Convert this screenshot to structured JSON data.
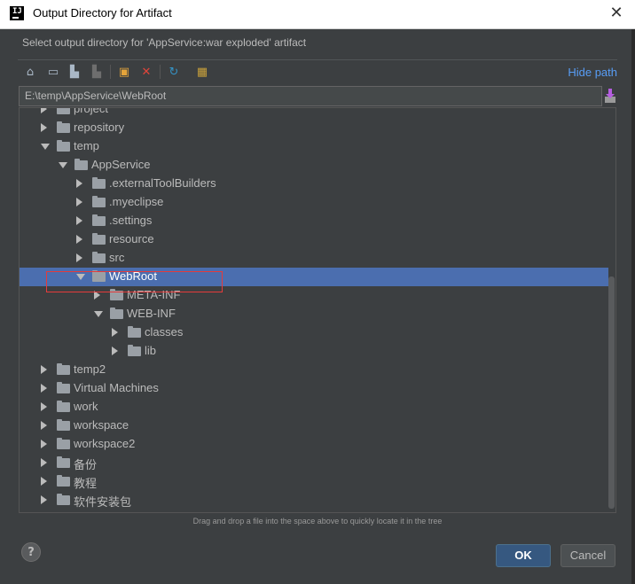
{
  "window": {
    "title": "Output Directory for Artifact",
    "close": "✕"
  },
  "dialog": {
    "description": "Select output directory for 'AppService:war exploded' artifact",
    "hide_path": "Hide path",
    "path_value": "E:\\temp\\AppService\\WebRoot",
    "hint": "Drag and drop a file into the space above to quickly locate it in the tree"
  },
  "toolbar": [
    {
      "name": "home-icon",
      "glyph": "⌂",
      "color": "#a9b7c6"
    },
    {
      "name": "desktop-icon",
      "glyph": "▭",
      "color": "#a9b7c6"
    },
    {
      "name": "project-icon",
      "glyph": "▙",
      "color": "#a9b7c6"
    },
    {
      "name": "module-icon",
      "glyph": "▙",
      "color": "#6e6e6e"
    },
    {
      "name": "new-folder-icon",
      "glyph": "▣",
      "color": "#e5a43a"
    },
    {
      "name": "delete-icon",
      "glyph": "✕",
      "color": "#e0453a"
    },
    {
      "name": "refresh-icon",
      "glyph": "↻",
      "color": "#3592c4"
    },
    {
      "name": "show-hidden-icon",
      "glyph": "▦",
      "color": "#c9a13b"
    }
  ],
  "tree": [
    {
      "label": "project",
      "depth": 0,
      "state": "collapsed"
    },
    {
      "label": "repository",
      "depth": 0,
      "state": "collapsed"
    },
    {
      "label": "temp",
      "depth": 0,
      "state": "expanded"
    },
    {
      "label": "AppService",
      "depth": 1,
      "state": "expanded"
    },
    {
      "label": ".externalToolBuilders",
      "depth": 2,
      "state": "collapsed"
    },
    {
      "label": ".myeclipse",
      "depth": 2,
      "state": "collapsed"
    },
    {
      "label": ".settings",
      "depth": 2,
      "state": "collapsed"
    },
    {
      "label": "resource",
      "depth": 2,
      "state": "collapsed"
    },
    {
      "label": "src",
      "depth": 2,
      "state": "collapsed"
    },
    {
      "label": "WebRoot",
      "depth": 2,
      "state": "expanded",
      "selected": true
    },
    {
      "label": "META-INF",
      "depth": 3,
      "state": "collapsed"
    },
    {
      "label": "WEB-INF",
      "depth": 3,
      "state": "expanded"
    },
    {
      "label": "classes",
      "depth": 4,
      "state": "collapsed"
    },
    {
      "label": "lib",
      "depth": 4,
      "state": "collapsed"
    },
    {
      "label": "temp2",
      "depth": 0,
      "state": "collapsed"
    },
    {
      "label": "Virtual Machines",
      "depth": 0,
      "state": "collapsed"
    },
    {
      "label": "work",
      "depth": 0,
      "state": "collapsed"
    },
    {
      "label": "workspace",
      "depth": 0,
      "state": "collapsed"
    },
    {
      "label": "workspace2",
      "depth": 0,
      "state": "collapsed"
    },
    {
      "label": "备份",
      "depth": 0,
      "state": "collapsed"
    },
    {
      "label": "教程",
      "depth": 0,
      "state": "collapsed"
    },
    {
      "label": "软件安装包",
      "depth": 0,
      "state": "collapsed"
    }
  ],
  "buttons": {
    "help": "?",
    "ok": "OK",
    "cancel": "Cancel"
  },
  "colors": {
    "accent_link": "#589df6",
    "selection": "#4b6eaf",
    "highlight_box": "#e53b3b",
    "ok_button": "#365880"
  }
}
